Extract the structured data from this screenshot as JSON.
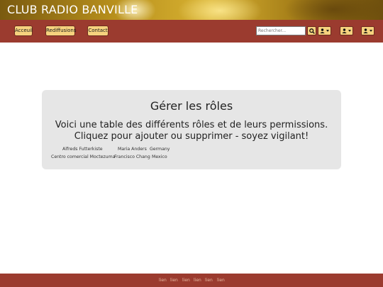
{
  "header": {
    "title": "CLUB RADIO BANVILLE"
  },
  "nav": {
    "items": [
      "Acceuil",
      "Rediffusions",
      "Contact"
    ]
  },
  "search": {
    "placeholder": "Rechercher..."
  },
  "main": {
    "title": "Gérer les rôles",
    "line1": "Voici une table des différents rôles et de leurs permissions.",
    "line2": "Cliquez pour ajouter ou supprimer - soyez vigilant!",
    "rows": [
      [
        "Alfreds Futterkiste",
        "Maria Anders",
        "Germany"
      ],
      [
        "Centro comercial Moctezuma",
        "Francisco Chang",
        "Mexico"
      ]
    ]
  },
  "footer": {
    "links": [
      "lien",
      "lien",
      "lien",
      "lien",
      "lien",
      "lien"
    ]
  },
  "colors": {
    "navbar": "#9b3b2f",
    "button": "#f6d27e",
    "panel": "#e6e6e6"
  }
}
